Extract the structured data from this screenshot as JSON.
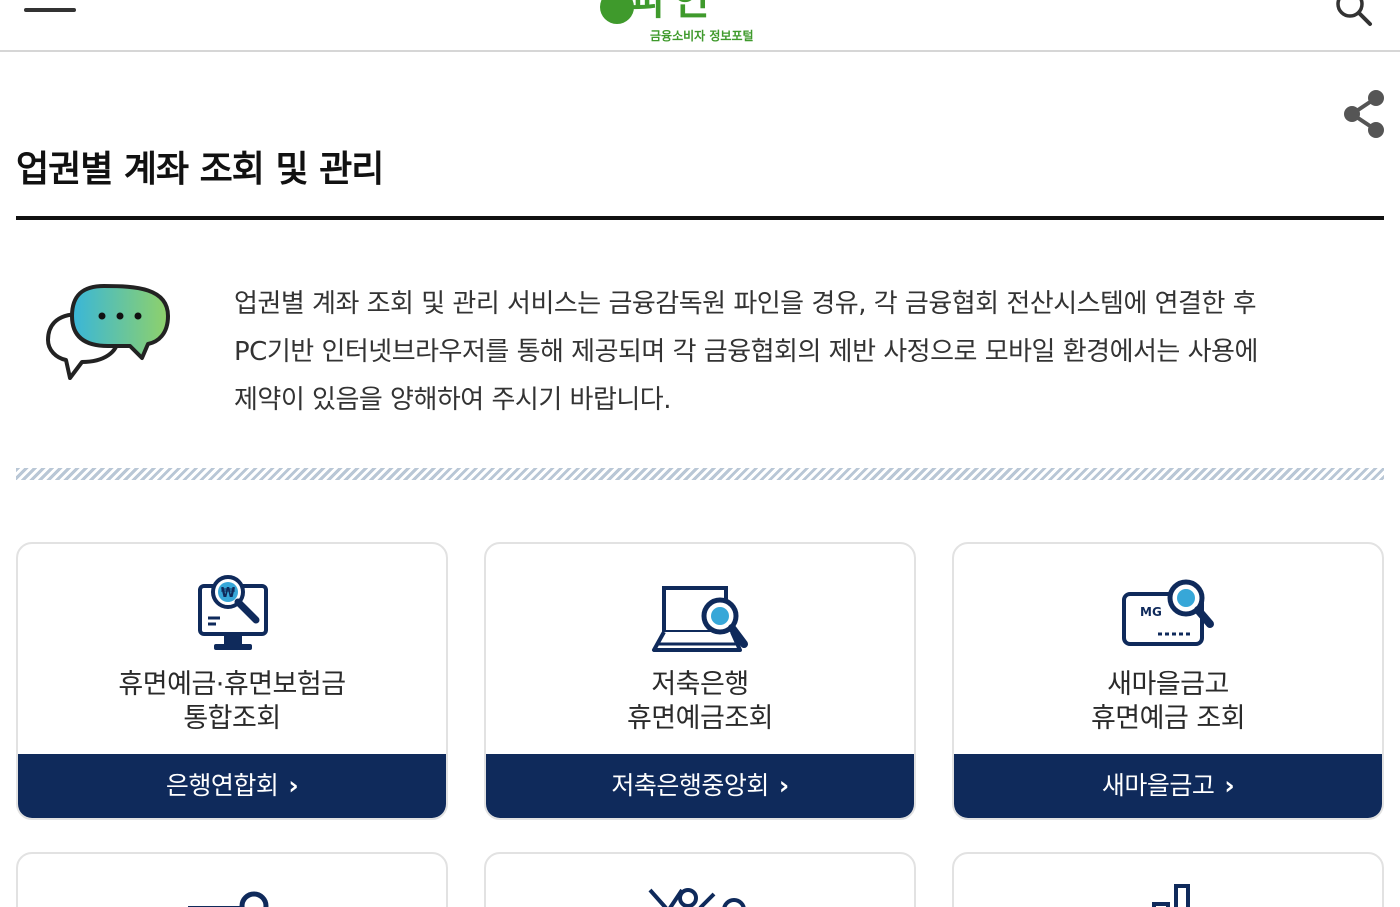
{
  "header": {
    "logo_main": "파인",
    "logo_sub": "금융소비자 정보포털",
    "menu_icon": "hamburger-menu-icon",
    "search_icon": "search-icon"
  },
  "page": {
    "title": "업권별 계좌 조회 및 관리",
    "share_icon": "share-icon"
  },
  "notice": {
    "icon": "chat-bubbles-icon",
    "line1": "업권별 계좌 조회 및 관리 서비스는 금융감독원 파인을 경유, 각 금융협회 전산시스템에 연결한 후",
    "line2": "PC기반 인터넷브라우저를 통해 제공되며 각 금융협회의 제반 사정으로 모바일 환경에서는 사용에",
    "line3": "제약이 있음을 양해하여 주시기 바랍니다."
  },
  "cards": [
    {
      "icon": "monitor-won-search-icon",
      "title_line1": "휴면예금·휴면보험금",
      "title_line2": "통합조회",
      "button": "은행연합회"
    },
    {
      "icon": "laptop-search-icon",
      "title_line1": "저축은행",
      "title_line2": "휴면예금조회",
      "button": "저축은행중앙회"
    },
    {
      "icon": "card-search-icon",
      "title_line1": "새마을금고",
      "title_line2": "휴면예금 조회",
      "button": "새마을금고"
    }
  ],
  "colors": {
    "brand_green": "#3f9a2c",
    "navy": "#0f2a5b"
  }
}
